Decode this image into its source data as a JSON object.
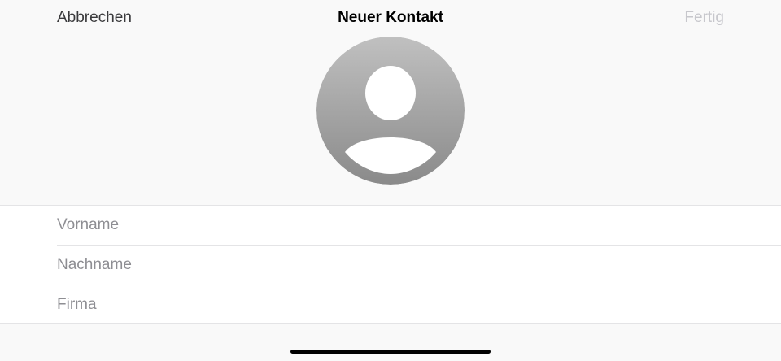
{
  "nav": {
    "cancel_label": "Abbrechen",
    "title": "Neuer Kontakt",
    "done_label": "Fertig",
    "done_enabled": false
  },
  "avatar": {
    "icon": "person-placeholder-icon"
  },
  "form": {
    "fields": [
      {
        "placeholder": "Vorname",
        "value": ""
      },
      {
        "placeholder": "Nachname",
        "value": ""
      },
      {
        "placeholder": "Firma",
        "value": ""
      }
    ]
  },
  "colors": {
    "background": "#f9f9f9",
    "field_background": "#ffffff",
    "separator": "#e4e4e6",
    "placeholder_text": "#8e8e93",
    "disabled_button": "#c7c7cc",
    "avatar_gradient_top": "#c0c0c0",
    "avatar_gradient_bottom": "#8a8a8a"
  }
}
